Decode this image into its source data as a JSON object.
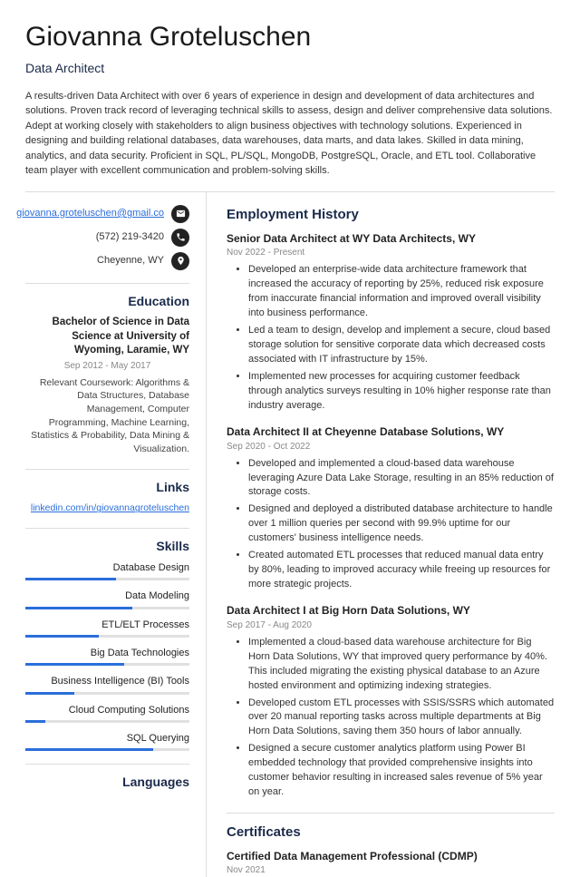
{
  "name": "Giovanna Groteluschen",
  "title": "Data Architect",
  "summary": "A results-driven Data Architect with over 6 years of experience in design and development of data architectures and solutions. Proven track record of leveraging technical skills to assess, design and deliver comprehensive data solutions. Adept at working closely with stakeholders to align business objectives with technology solutions. Experienced in designing and building relational databases, data warehouses, data marts, and data lakes. Skilled in data mining, analytics, and data security. Proficient in SQL, PL/SQL, MongoDB, PostgreSQL, Oracle, and ETL tool. Collaborative team player with excellent communication and problem-solving skills.",
  "contact": {
    "email": "giovanna.groteluschen@gmail.co",
    "phone": "(572) 219-3420",
    "location": "Cheyenne, WY"
  },
  "sections": {
    "education": "Education",
    "links": "Links",
    "skills": "Skills",
    "languages": "Languages",
    "employment": "Employment History",
    "certificates": "Certificates"
  },
  "education": {
    "degree": "Bachelor of Science in Data Science at University of Wyoming, Laramie, WY",
    "dates": "Sep 2012 - May 2017",
    "desc": "Relevant Coursework: Algorithms & Data Structures, Database Management, Computer Programming, Machine Learning, Statistics & Probability, Data Mining & Visualization."
  },
  "links": {
    "item": "linkedin.com/in/giovannagroteluschen"
  },
  "skills": [
    {
      "name": "Database Design",
      "pct": 55
    },
    {
      "name": "Data Modeling",
      "pct": 65
    },
    {
      "name": "ETL/ELT Processes",
      "pct": 45
    },
    {
      "name": "Big Data Technologies",
      "pct": 60
    },
    {
      "name": "Business Intelligence (BI) Tools",
      "pct": 30
    },
    {
      "name": "Cloud Computing Solutions",
      "pct": 12
    },
    {
      "name": "SQL Querying",
      "pct": 78
    }
  ],
  "jobs": [
    {
      "title": "Senior Data Architect at WY Data Architects, WY",
      "dates": "Nov 2022 - Present",
      "bullets": [
        "Developed an enterprise-wide data architecture framework that increased the accuracy of reporting by 25%, reduced risk exposure from inaccurate financial information and improved overall visibility into business performance.",
        "Led a team to design, develop and implement a secure, cloud based storage solution for sensitive corporate data which decreased costs associated with IT infrastructure by 15%.",
        "Implemented new processes for acquiring customer feedback through analytics surveys resulting in 10% higher response rate than industry average."
      ]
    },
    {
      "title": "Data Architect II at Cheyenne Database Solutions, WY",
      "dates": "Sep 2020 - Oct 2022",
      "bullets": [
        "Developed and implemented a cloud-based data warehouse leveraging Azure Data Lake Storage, resulting in an 85% reduction of storage costs.",
        "Designed and deployed a distributed database architecture to handle over 1 million queries per second with 99.9% uptime for our customers' business intelligence needs.",
        "Created automated ETL processes that reduced manual data entry by 80%, leading to improved accuracy while freeing up resources for more strategic projects."
      ]
    },
    {
      "title": "Data Architect I at Big Horn Data Solutions, WY",
      "dates": "Sep 2017 - Aug 2020",
      "bullets": [
        "Implemented a cloud-based data warehouse architecture for Big Horn Data Solutions, WY that improved query performance by 40%. This included migrating the existing physical database to an Azure hosted environment and optimizing indexing strategies.",
        "Developed custom ETL processes with SSIS/SSRS which automated over 20 manual reporting tasks across multiple departments at Big Horn Data Solutions, saving them 350 hours of labor annually.",
        "Designed a secure customer analytics platform using Power BI embedded technology that provided comprehensive insights into customer behavior resulting in increased sales revenue of 5% year on year."
      ]
    }
  ],
  "certificates": {
    "title": "Certified Data Management Professional (CDMP)",
    "date": "Nov 2021"
  }
}
